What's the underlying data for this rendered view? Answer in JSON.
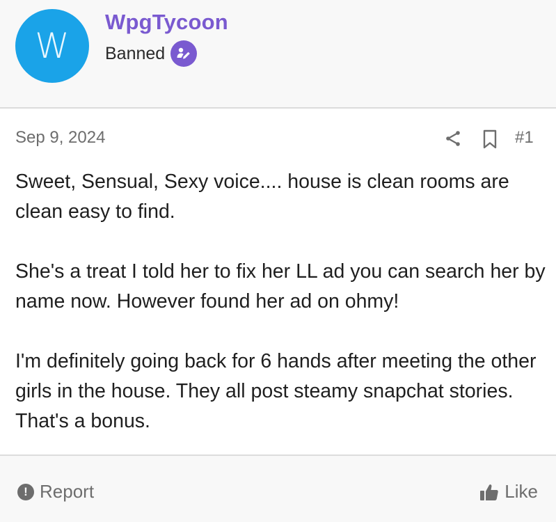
{
  "user": {
    "avatar_letter": "W",
    "avatar_color": "#1aa3e8",
    "username": "WpgTycoon",
    "username_color": "#7a5ad0",
    "title": "Banned",
    "badge_icon": "user-pen-icon"
  },
  "meta": {
    "date": "Sep 9, 2024",
    "share_icon": "share-icon",
    "bookmark_icon": "bookmark-icon",
    "post_number": "#1"
  },
  "body": {
    "paragraphs": [
      "Sweet, Sensual, Sexy voice.... house is clean rooms are clean easy to find.",
      "She's a treat I told her to fix her LL ad you can search her by name now. However found her ad on ohmy!",
      "I'm definitely going back for 6 hands after meeting the other girls in the house. They all post steamy snapchat stories. That's a bonus."
    ]
  },
  "footer": {
    "report_label": "Report",
    "report_icon": "exclamation-circle-icon",
    "like_label": "Like",
    "like_icon": "thumbs-up-icon"
  }
}
